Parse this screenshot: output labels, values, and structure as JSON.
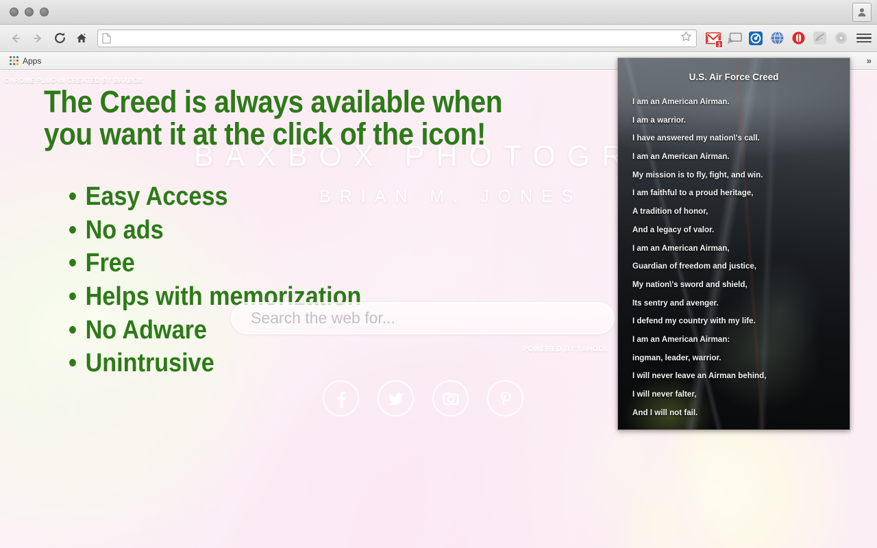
{
  "browser": {
    "window_controls": [
      "close",
      "minimize",
      "maximize"
    ],
    "profile_icon": "person-icon",
    "back_label": "Back",
    "forward_label": "Forward",
    "reload_label": "Reload",
    "home_label": "Home",
    "omnibox": {
      "value": "",
      "placeholder": ""
    },
    "star_label": "Bookmark this page",
    "menu_label": "Customize and control Google Chrome",
    "extensions": [
      {
        "name": "gmail-icon",
        "badge": "3"
      },
      {
        "name": "cast-icon",
        "badge": ""
      },
      {
        "name": "pocket-icon",
        "badge": ""
      },
      {
        "name": "globe-icon",
        "badge": ""
      },
      {
        "name": "adblock-icon",
        "badge": ""
      },
      {
        "name": "disabled-extension-icon",
        "badge": ""
      },
      {
        "name": "disc-extension-icon",
        "badge": ""
      }
    ],
    "bookmarks_bar": {
      "apps_label": "Apps",
      "overflow_label": "»"
    }
  },
  "page": {
    "created_by": "CHROME PLUG-IN CREATED BY BAXBOX",
    "headline": "The Creed is always available when you want it at the click of the icon!",
    "bullets": [
      "Easy Access",
      "No ads",
      "Free",
      "Helps with memorization",
      "No Adware",
      "Unintrusive"
    ],
    "watermark_main": "BAXBOX PHOTOGRA",
    "watermark_sub": "BRIAN M. JONES",
    "search": {
      "placeholder": "Search the web for...",
      "value": "",
      "powered_by": "POWERED BY YAHOO!"
    },
    "socials": [
      {
        "name": "facebook-icon",
        "glyph": "f"
      },
      {
        "name": "twitter-icon",
        "glyph": "t"
      },
      {
        "name": "instagram-icon",
        "glyph": "i"
      },
      {
        "name": "pinterest-icon",
        "glyph": "p"
      }
    ],
    "colors": {
      "accent_green": "#2d7a18",
      "background_pink": "#f9eaf2"
    }
  },
  "popup": {
    "title": "U.S. Air Force Creed",
    "lines": [
      "I am an American Airman.",
      "I am a warrior.",
      "I have answered my nation\\'s call.",
      "I am an American Airman.",
      "My mission is to fly, fight, and win.",
      "I am faithful to a proud heritage,",
      "A tradition of honor,",
      "And a legacy of valor.",
      "I am an American Airman,",
      "Guardian of freedom and justice,",
      "My nation\\'s sword and shield,",
      "Its sentry and avenger.",
      "I defend my country with my life.",
      "I am an American Airman:",
      "ingman, leader, warrior.",
      "I will never leave an Airman behind,",
      "I will never falter,",
      "And I will not fail."
    ]
  }
}
